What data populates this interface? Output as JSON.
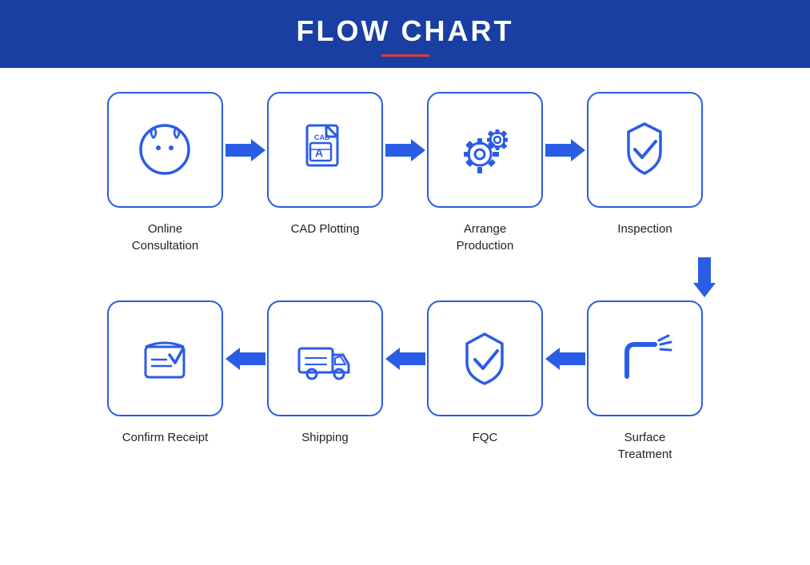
{
  "header": {
    "title": "FLOW CHART"
  },
  "steps": {
    "row1": [
      {
        "id": "online-consultation",
        "label": "Online\nConsultation"
      },
      {
        "id": "cad-plotting",
        "label": "CAD Plotting"
      },
      {
        "id": "arrange-production",
        "label": "Arrange\nProduction"
      },
      {
        "id": "inspection",
        "label": "Inspection"
      }
    ],
    "row2": [
      {
        "id": "confirm-receipt",
        "label": "Confirm Receipt"
      },
      {
        "id": "shipping",
        "label": "Shipping"
      },
      {
        "id": "fqc",
        "label": "FQC"
      },
      {
        "id": "surface-treatment",
        "label": "Surface\nTreatment"
      }
    ]
  }
}
